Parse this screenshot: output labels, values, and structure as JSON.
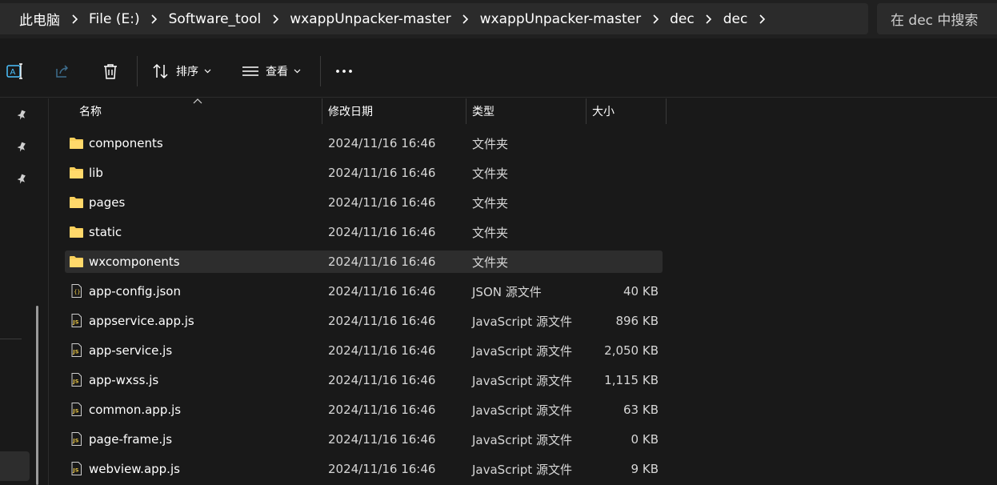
{
  "address": {
    "crumbs": [
      "此电脑",
      "File (E:)",
      "Software_tool",
      "wxappUnpacker-master",
      "wxappUnpacker-master",
      "dec",
      "dec"
    ],
    "search_placeholder": "在 dec 中搜索"
  },
  "toolbar": {
    "sort_label": "排序",
    "view_label": "查看"
  },
  "columns": {
    "name": "名称",
    "date": "修改日期",
    "type": "类型",
    "size": "大小"
  },
  "files": [
    {
      "name": "components",
      "date": "2024/11/16 16:46",
      "type": "文件夹",
      "size": "",
      "icon": "folder-icon"
    },
    {
      "name": "lib",
      "date": "2024/11/16 16:46",
      "type": "文件夹",
      "size": "",
      "icon": "folder-icon"
    },
    {
      "name": "pages",
      "date": "2024/11/16 16:46",
      "type": "文件夹",
      "size": "",
      "icon": "folder-icon"
    },
    {
      "name": "static",
      "date": "2024/11/16 16:46",
      "type": "文件夹",
      "size": "",
      "icon": "folder-icon"
    },
    {
      "name": "wxcomponents",
      "date": "2024/11/16 16:46",
      "type": "文件夹",
      "size": "",
      "icon": "folder-icon",
      "selected": true
    },
    {
      "name": "app-config.json",
      "date": "2024/11/16 16:46",
      "type": "JSON 源文件",
      "size": "40 KB",
      "icon": "json-file-icon"
    },
    {
      "name": "appservice.app.js",
      "date": "2024/11/16 16:46",
      "type": "JavaScript 源文件",
      "size": "896 KB",
      "icon": "js-file-icon"
    },
    {
      "name": "app-service.js",
      "date": "2024/11/16 16:46",
      "type": "JavaScript 源文件",
      "size": "2,050 KB",
      "icon": "js-file-icon"
    },
    {
      "name": "app-wxss.js",
      "date": "2024/11/16 16:46",
      "type": "JavaScript 源文件",
      "size": "1,115 KB",
      "icon": "js-file-icon"
    },
    {
      "name": "common.app.js",
      "date": "2024/11/16 16:46",
      "type": "JavaScript 源文件",
      "size": "63 KB",
      "icon": "js-file-icon"
    },
    {
      "name": "page-frame.js",
      "date": "2024/11/16 16:46",
      "type": "JavaScript 源文件",
      "size": "0 KB",
      "icon": "js-file-icon"
    },
    {
      "name": "webview.app.js",
      "date": "2024/11/16 16:46",
      "type": "JavaScript 源文件",
      "size": "9 KB",
      "icon": "js-file-icon"
    }
  ],
  "colors": {
    "folder": "#f8cf5b",
    "accent": "#4cc2ff",
    "selected_row": "#2d2d2d"
  }
}
